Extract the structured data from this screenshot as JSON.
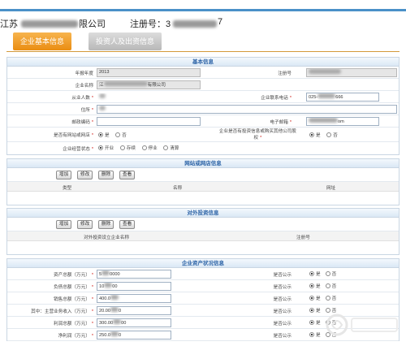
{
  "header": {
    "seg1": "江苏",
    "seg2": "限公司",
    "reg_label": "注册号：3",
    "reg_tail": "7"
  },
  "tabs": {
    "basic": "企业基本信息",
    "investor": "投资人及出资信息"
  },
  "basic_info": {
    "title": "基本信息",
    "year_label": "年报年度",
    "year_value": "2013",
    "regno_label": "注册号",
    "name_label": "企业名称",
    "name_prefix": "江",
    "name_suffix": "有限公司",
    "staff_label": "从业人数",
    "phone_label": "企业联系电话",
    "phone_prefix": "025-",
    "phone_suffix": "666",
    "address_label": "住所",
    "postcode_label": "邮政编码",
    "email_label": "电子邮箱",
    "email_suffix": "om",
    "transfer_label": "是否有网站或网店",
    "invest_label_1": "企业是否有投资信息或购买其他公司股",
    "invest_label_2": "权",
    "status_label": "企业经营状态",
    "yes": "是",
    "no": "否",
    "status_options": [
      "开业",
      "存续",
      "停业",
      "清算"
    ]
  },
  "website_info": {
    "title": "网站或网店信息",
    "buttons": [
      "增加",
      "修改",
      "删除",
      "查看"
    ],
    "columns": [
      "类型",
      "名称",
      "网址"
    ]
  },
  "outward_investment": {
    "title": "对外投资信息",
    "buttons": [
      "增加",
      "修改",
      "删除",
      "查看"
    ],
    "columns": [
      "对外投资设立企业名称",
      "注册号"
    ]
  },
  "asset_info": {
    "title": "企业资产状况信息",
    "public_label": "是否公示",
    "yes": "是",
    "no": "否",
    "rows": [
      {
        "label": "资产总额（万元）",
        "prefix": "5",
        "suffix": "0000"
      },
      {
        "label": "负债总额（万元）",
        "prefix": "10",
        "suffix": "00"
      },
      {
        "label": "销售总额（万元）",
        "prefix": "400.0",
        "suffix": ""
      },
      {
        "label": "其中：主营业务收入（万元）",
        "prefix": "20.00",
        "suffix": "0"
      },
      {
        "label": "利润总额（万元）",
        "prefix": "300.00",
        "suffix": "00"
      },
      {
        "label": "净利润（万元）",
        "prefix": "250.0",
        "suffix": "0"
      }
    ]
  }
}
